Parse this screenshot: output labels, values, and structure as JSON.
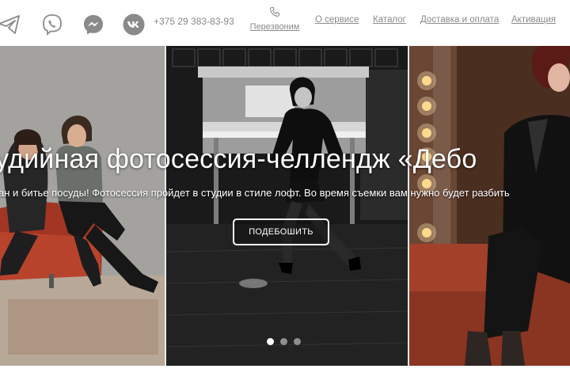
{
  "header": {
    "phone": "+375 29 383-83-93",
    "callback_label": "Перезвоним",
    "nav": [
      "О сервисе",
      "Каталог",
      "Доставка и оплата",
      "Активация"
    ],
    "social_icons": [
      "telegram-icon",
      "viber-icon",
      "messenger-icon",
      "vk-icon"
    ]
  },
  "hero": {
    "headline": "удийная фотосессия-челлендж «Дебо",
    "subtext": "ан и битье посуды! Фотосессия пройдет в студии в стиле лофт. Во время съемки вам нужно будет разбить",
    "cta_label": "ПОДЕБОШИТЬ",
    "slides_count": 3,
    "active_slide": 1
  },
  "colors": {
    "icon_gray": "#8a8a8a",
    "text_white": "#ffffff",
    "separator": "#e9e9e9"
  }
}
